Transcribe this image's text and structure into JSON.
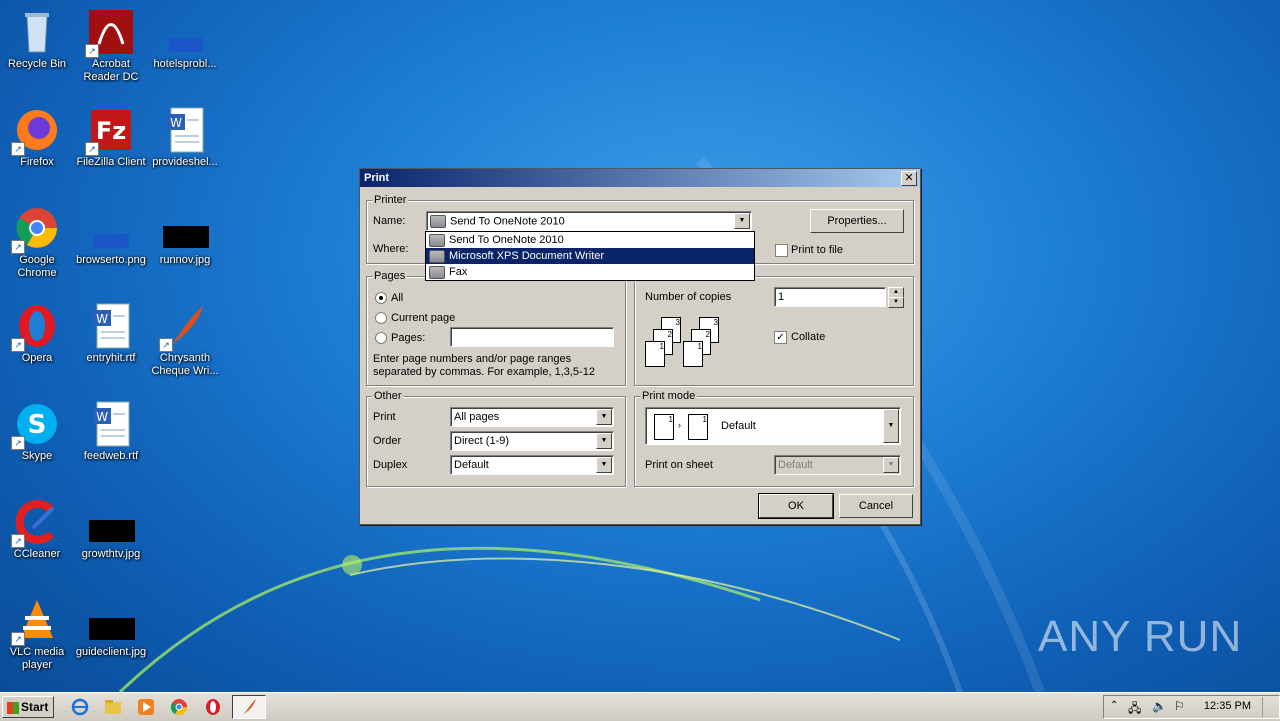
{
  "desktop_icons": [
    {
      "label": "Recycle Bin",
      "icon": "recycle-bin-icon"
    },
    {
      "label": "Acrobat Reader DC",
      "icon": "acrobat-icon"
    },
    {
      "label": "hotelsprobl...",
      "icon": "file-icon"
    },
    {
      "label": "Firefox",
      "icon": "firefox-icon"
    },
    {
      "label": "FileZilla Client",
      "icon": "filezilla-icon"
    },
    {
      "label": "provideshel...",
      "icon": "word-doc-icon"
    },
    {
      "label": "Google Chrome",
      "icon": "chrome-icon"
    },
    {
      "label": "browserto.png",
      "icon": "image-file-icon"
    },
    {
      "label": "runnov.jpg",
      "icon": "image-file-icon"
    },
    {
      "label": "Opera",
      "icon": "opera-icon"
    },
    {
      "label": "entryhit.rtf",
      "icon": "word-doc-icon"
    },
    {
      "label": "Chrysanth Cheque Wri...",
      "icon": "quill-icon"
    },
    {
      "label": "Skype",
      "icon": "skype-icon"
    },
    {
      "label": "feedweb.rtf",
      "icon": "word-doc-icon"
    },
    {
      "label": "CCleaner",
      "icon": "ccleaner-icon"
    },
    {
      "label": "growthtv.jpg",
      "icon": "image-file-icon"
    },
    {
      "label": "VLC media player",
      "icon": "vlc-icon"
    },
    {
      "label": "guideclient.jpg",
      "icon": "image-file-icon"
    }
  ],
  "dialog": {
    "title": "Print",
    "close": "✕",
    "printer": {
      "group_label": "Printer",
      "name_label": "Name:",
      "name_value": "Send To OneNote 2010",
      "where_label": "Where:",
      "properties_label": "Properties...",
      "print_to_file_label": "Print to file"
    },
    "dropdown_options": [
      "Send To OneNote 2010",
      "Microsoft XPS Document Writer",
      "Fax"
    ],
    "pages": {
      "group_label": "Pages",
      "all_label": "All",
      "current_label": "Current page",
      "pages_label": "Pages:",
      "hint": "Enter page numbers and/or page ranges separated by commas. For example, 1,3,5-12"
    },
    "copies": {
      "number_label": "Number of copies",
      "number_value": "1",
      "collate_label": "Collate"
    },
    "other": {
      "group_label": "Other",
      "print_label": "Print",
      "print_value": "All pages",
      "order_label": "Order",
      "order_value": "Direct (1-9)",
      "duplex_label": "Duplex",
      "duplex_value": "Default"
    },
    "print_mode": {
      "group_label": "Print mode",
      "mode_value": "Default",
      "print_on_sheet_label": "Print on sheet",
      "print_on_sheet_value": "Default"
    },
    "ok_label": "OK",
    "cancel_label": "Cancel"
  },
  "taskbar": {
    "start_label": "Start",
    "clock": "12:35 PM"
  },
  "watermark": "ANY RUN"
}
